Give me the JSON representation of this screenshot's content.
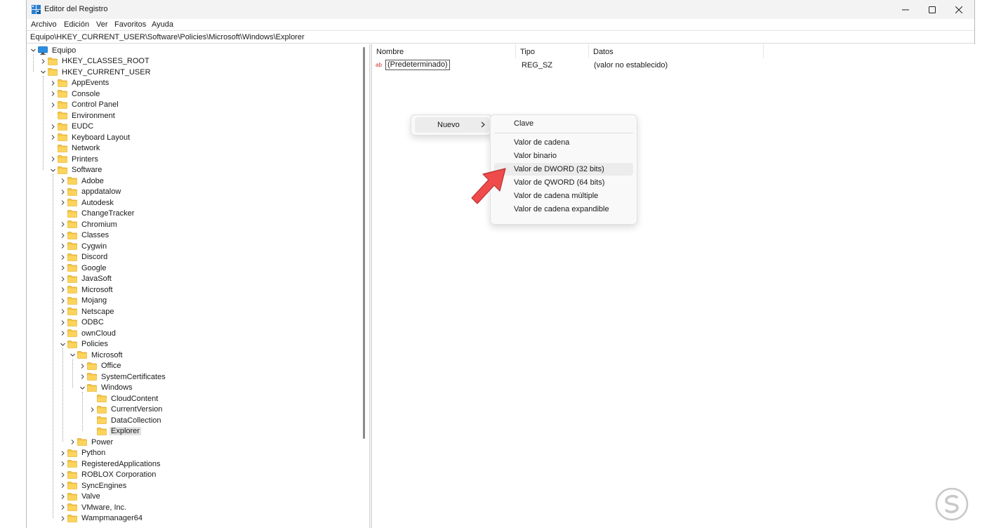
{
  "window": {
    "title": "Editor del Registro",
    "icon": "registry-editor-icon",
    "controls": {
      "minimize": "minimize-icon",
      "maximize": "maximize-icon",
      "close": "close-icon"
    }
  },
  "menu": {
    "items": [
      "Archivo",
      "Edición",
      "Ver",
      "Favoritos",
      "Ayuda"
    ]
  },
  "address": {
    "path": "Equipo\\HKEY_CURRENT_USER\\Software\\Policies\\Microsoft\\Windows\\Explorer"
  },
  "tree": {
    "nodes": [
      {
        "label": "Equipo",
        "depth": 0,
        "state": "expanded",
        "icon": "computer-icon"
      },
      {
        "label": "HKEY_CLASSES_ROOT",
        "depth": 1,
        "state": "collapsed"
      },
      {
        "label": "HKEY_CURRENT_USER",
        "depth": 1,
        "state": "expanded"
      },
      {
        "label": "AppEvents",
        "depth": 2,
        "state": "collapsed"
      },
      {
        "label": "Console",
        "depth": 2,
        "state": "collapsed"
      },
      {
        "label": "Control Panel",
        "depth": 2,
        "state": "collapsed"
      },
      {
        "label": "Environment",
        "depth": 2,
        "state": "leaf"
      },
      {
        "label": "EUDC",
        "depth": 2,
        "state": "collapsed"
      },
      {
        "label": "Keyboard Layout",
        "depth": 2,
        "state": "collapsed"
      },
      {
        "label": "Network",
        "depth": 2,
        "state": "leaf"
      },
      {
        "label": "Printers",
        "depth": 2,
        "state": "collapsed"
      },
      {
        "label": "Software",
        "depth": 2,
        "state": "expanded"
      },
      {
        "label": "Adobe",
        "depth": 3,
        "state": "collapsed"
      },
      {
        "label": "appdatalow",
        "depth": 3,
        "state": "collapsed"
      },
      {
        "label": "Autodesk",
        "depth": 3,
        "state": "collapsed"
      },
      {
        "label": "ChangeTracker",
        "depth": 3,
        "state": "leaf"
      },
      {
        "label": "Chromium",
        "depth": 3,
        "state": "collapsed"
      },
      {
        "label": "Classes",
        "depth": 3,
        "state": "collapsed"
      },
      {
        "label": "Cygwin",
        "depth": 3,
        "state": "collapsed"
      },
      {
        "label": "Discord",
        "depth": 3,
        "state": "collapsed"
      },
      {
        "label": "Google",
        "depth": 3,
        "state": "collapsed"
      },
      {
        "label": "JavaSoft",
        "depth": 3,
        "state": "collapsed"
      },
      {
        "label": "Microsoft",
        "depth": 3,
        "state": "collapsed"
      },
      {
        "label": "Mojang",
        "depth": 3,
        "state": "collapsed"
      },
      {
        "label": "Netscape",
        "depth": 3,
        "state": "collapsed"
      },
      {
        "label": "ODBC",
        "depth": 3,
        "state": "collapsed"
      },
      {
        "label": "ownCloud",
        "depth": 3,
        "state": "collapsed"
      },
      {
        "label": "Policies",
        "depth": 3,
        "state": "expanded"
      },
      {
        "label": "Microsoft",
        "depth": 4,
        "state": "expanded"
      },
      {
        "label": "Office",
        "depth": 5,
        "state": "collapsed"
      },
      {
        "label": "SystemCertificates",
        "depth": 5,
        "state": "collapsed"
      },
      {
        "label": "Windows",
        "depth": 5,
        "state": "expanded"
      },
      {
        "label": "CloudContent",
        "depth": 6,
        "state": "leaf"
      },
      {
        "label": "CurrentVersion",
        "depth": 6,
        "state": "collapsed"
      },
      {
        "label": "DataCollection",
        "depth": 6,
        "state": "leaf"
      },
      {
        "label": "Explorer",
        "depth": 6,
        "state": "leaf",
        "selected": true
      },
      {
        "label": "Power",
        "depth": 4,
        "state": "collapsed"
      },
      {
        "label": "Python",
        "depth": 3,
        "state": "collapsed"
      },
      {
        "label": "RegisteredApplications",
        "depth": 3,
        "state": "collapsed"
      },
      {
        "label": "ROBLOX Corporation",
        "depth": 3,
        "state": "collapsed"
      },
      {
        "label": "SyncEngines",
        "depth": 3,
        "state": "collapsed"
      },
      {
        "label": "Valve",
        "depth": 3,
        "state": "collapsed"
      },
      {
        "label": "VMware, Inc.",
        "depth": 3,
        "state": "collapsed"
      },
      {
        "label": "Wampmanager64",
        "depth": 3,
        "state": "collapsed"
      }
    ]
  },
  "values": {
    "columns": [
      "Nombre",
      "Tipo",
      "Datos"
    ],
    "rows": [
      {
        "name": "(Predeterminado)",
        "type": "REG_SZ",
        "data": "(valor no establecido)",
        "icon": "string-value-icon"
      }
    ]
  },
  "context_menu": {
    "parent_label": "Nuevo",
    "submenu": [
      {
        "label": "Clave",
        "hover": false
      },
      {
        "label": "Valor de cadena",
        "hover": false
      },
      {
        "label": "Valor binario",
        "hover": false
      },
      {
        "label": "Valor de DWORD (32 bits)",
        "hover": true
      },
      {
        "label": "Valor de QWORD (64 bits)",
        "hover": false
      },
      {
        "label": "Valor de cadena múltiple",
        "hover": false
      },
      {
        "label": "Valor de cadena expandible",
        "hover": false
      }
    ]
  },
  "annotation": {
    "icon": "red-pointer-arrow-icon",
    "color": "#ef4b4b"
  },
  "watermark": {
    "icon": "watermark-logo-icon"
  }
}
